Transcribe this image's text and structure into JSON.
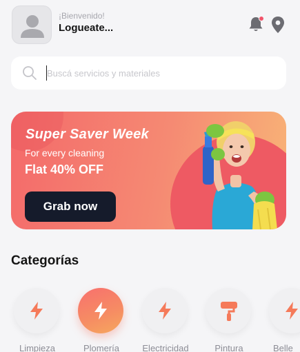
{
  "header": {
    "greeting": "¡Bienvenido!",
    "title": "Logueate...",
    "avatar_icon": "user-avatar-icon",
    "notification_icon": "bell-icon",
    "location_icon": "map-pin-icon"
  },
  "search": {
    "placeholder": "Buscá servicios y materiales",
    "value": "",
    "icon": "search-icon"
  },
  "banner": {
    "title": "Super Saver Week",
    "subtitle": "For every cleaning",
    "offer": "Flat 40% OFF",
    "cta_label": "Grab now"
  },
  "categories": {
    "title": "Categorías",
    "items": [
      {
        "label": "Limpieza",
        "icon": "lightning-icon",
        "active": false
      },
      {
        "label": "Plomería",
        "icon": "lightning-icon",
        "active": true
      },
      {
        "label": "Electricidad",
        "icon": "lightning-icon",
        "active": false
      },
      {
        "label": "Pintura",
        "icon": "paint-roller-icon",
        "active": false
      },
      {
        "label": "Belle",
        "icon": "lightning-icon",
        "active": false
      }
    ]
  },
  "colors": {
    "accent": "#f5725f",
    "dark_button": "#151b2b",
    "background": "#f5f5f7"
  }
}
